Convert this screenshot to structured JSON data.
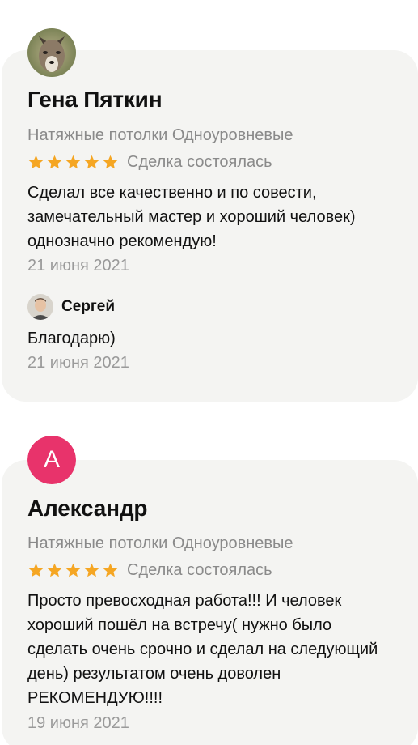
{
  "reviews": [
    {
      "author": "Гена Пяткин",
      "avatar_icon": "wolf-photo-avatar",
      "category": "Натяжные потолки Одноуровневые",
      "rating": 5,
      "deal_status": "Сделка состоялась",
      "text": "Сделал все качественно и по совести, замечательный мастер и хороший человек) однозначно рекомендую!",
      "date": "21 июня 2021",
      "reply": {
        "author": "Сергей",
        "avatar_icon": "person-photo-avatar",
        "text": "Благодарю)",
        "date": "21 июня 2021"
      }
    },
    {
      "author": "Александр",
      "avatar_letter": "А",
      "avatar_color": "#e8336b",
      "category": "Натяжные потолки Одноуровневые",
      "rating": 5,
      "deal_status": "Сделка состоялась",
      "text": "Просто превосходная работа!!! И человек хороший пошёл на встречу( нужно было сделать очень срочно и сделал на следующий день) результатом очень доволен РЕКОМЕНДУЮ!!!!",
      "date": "19 июня 2021"
    }
  ],
  "colors": {
    "card_bg": "#f4f4f2",
    "star": "#f5a623",
    "muted_text": "#8a8a8a"
  }
}
